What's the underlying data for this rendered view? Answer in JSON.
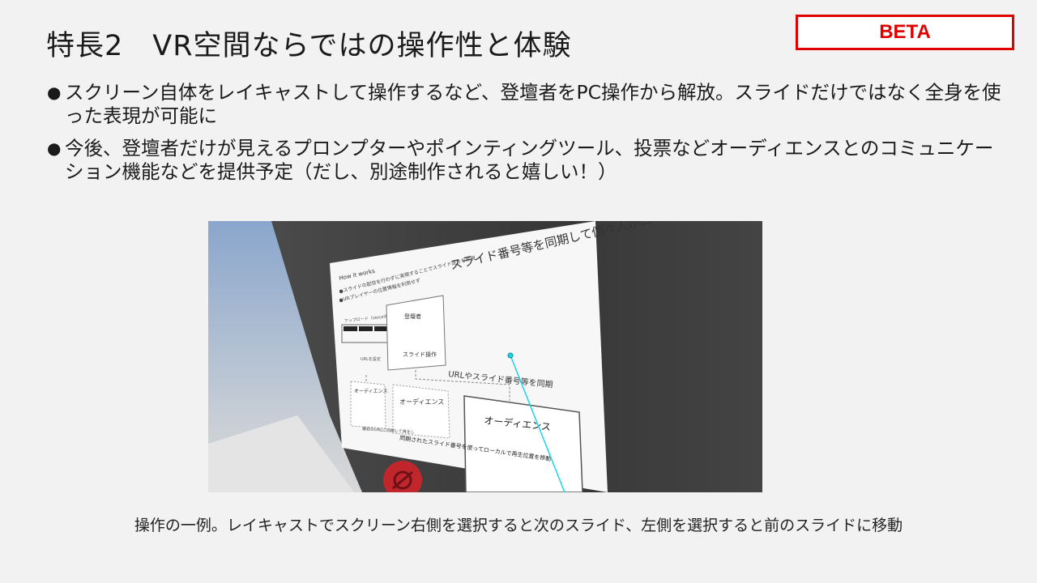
{
  "title": "特長2　VR空間ならではの操作性と体験",
  "badge": "BETA",
  "bullets": [
    "スクリーン自体をレイキャストして操作するなど、登壇者をPC操作から解放。スライドだけではなく全身を使った表現が可能に",
    "今後、登壇者だけが見えるプロンプターやポインティングツール、投票などオーディエンスとのコミュニケーション機能などを提供予定（だし、別途制作されると嬉しい！）"
  ],
  "screenshot": {
    "slide_heading": "How it works",
    "slide_title": "スライド番号等を同期して個々人がローカルで再生",
    "slide_line1": "●スライドの配信を行わずに実現することでスライド送りを実現",
    "slide_line2": "●VRプレイヤーの位置情報を利用せず",
    "small_label": "アップロード（Vercel等）",
    "url_label": "URLを設定",
    "presenter_box_title": "登壇者",
    "presenter_box_sub": "スライド操作",
    "sync_label": "URLやスライド番号等を同期",
    "audience_label": "オーディエンス",
    "bottom_note_left": "最初のURLに同期して再生し",
    "bottom_note": "同期されたスライド番号を使ってローカルで再生位置を移動"
  },
  "caption": "操作の一例。レイキャストでスクリーン右側を選択すると次のスライド、左側を選択すると前のスライドに移動",
  "colors": {
    "accent_red": "#e00000",
    "ray": "#19d6e6",
    "background": "#f2f2f2"
  }
}
